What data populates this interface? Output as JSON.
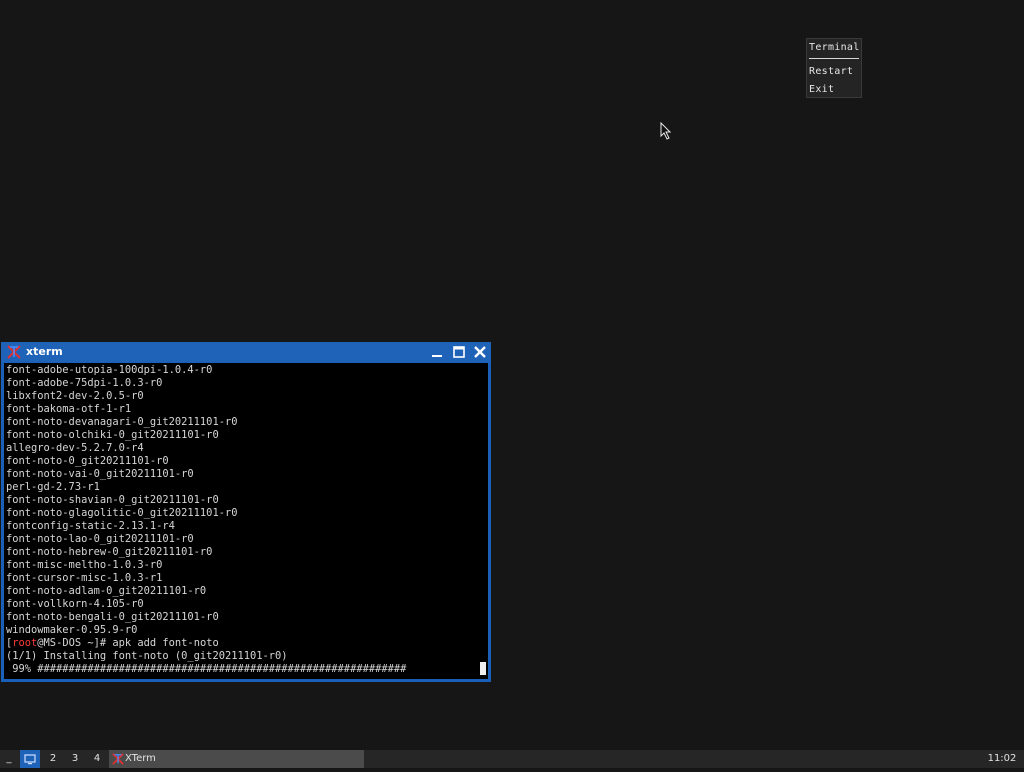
{
  "root_menu": {
    "title": "Terminal",
    "items": [
      "Restart",
      "Exit"
    ]
  },
  "xterm": {
    "title": "xterm",
    "lines": [
      "font-adobe-utopia-100dpi-1.0.4-r0",
      "font-adobe-75dpi-1.0.3-r0",
      "libxfont2-dev-2.0.5-r0",
      "font-bakoma-otf-1-r1",
      "font-noto-devanagari-0_git20211101-r0",
      "font-noto-olchiki-0_git20211101-r0",
      "allegro-dev-5.2.7.0-r4",
      "font-noto-0_git20211101-r0",
      "font-noto-vai-0_git20211101-r0",
      "perl-gd-2.73-r1",
      "font-noto-shavian-0_git20211101-r0",
      "font-noto-glagolitic-0_git20211101-r0",
      "fontconfig-static-2.13.1-r4",
      "font-noto-lao-0_git20211101-r0",
      "font-noto-hebrew-0_git20211101-r0",
      "font-misc-meltho-1.0.3-r0",
      "font-cursor-misc-1.0.3-r1",
      "font-noto-adlam-0_git20211101-r0",
      "font-vollkorn-4.105-r0",
      "font-noto-bengali-0_git20211101-r0",
      "windowmaker-0.95.9-r0"
    ],
    "prompt_user": "root",
    "prompt_rest": "@MS-DOS ~]# apk add font-noto",
    "prompt_open": "[",
    "install_line": "(1/1) Installing font-noto (0_git20211101-r0)",
    "progress_line": " 99% ###########################################################",
    "progress_percent": 99
  },
  "taskbar": {
    "minimize_label": "_",
    "workspaces": [
      "2",
      "3",
      "4"
    ],
    "task_label": "XTerm",
    "clock": "11:02"
  },
  "colors": {
    "desktop": "#161616",
    "titlebar": "#1f63b9",
    "prompt_user": "#ff3a3a",
    "terminal_bg": "#000000"
  }
}
